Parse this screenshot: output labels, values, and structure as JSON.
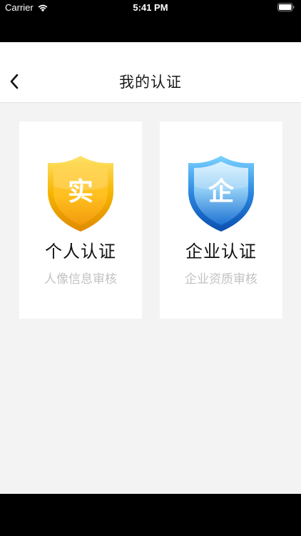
{
  "status_bar": {
    "carrier": "Carrier",
    "time": "5:41 PM",
    "wifi_icon": "wifi-icon",
    "battery_icon": "battery-icon"
  },
  "nav": {
    "title": "我的认证",
    "back_icon": "chevron-left-icon"
  },
  "cards": [
    {
      "badge_char": "实",
      "title": "个人认证",
      "subtitle": "人像信息审核",
      "icon": "gold-shield-icon",
      "color": "#f5b800"
    },
    {
      "badge_char": "企",
      "title": "企业认证",
      "subtitle": "企业资质审核",
      "icon": "blue-shield-icon",
      "color": "#1e6fd0"
    }
  ],
  "colors": {
    "page_background": "#f3f3f3",
    "card_background": "#ffffff",
    "subtitle_text": "#c2c2c2"
  }
}
